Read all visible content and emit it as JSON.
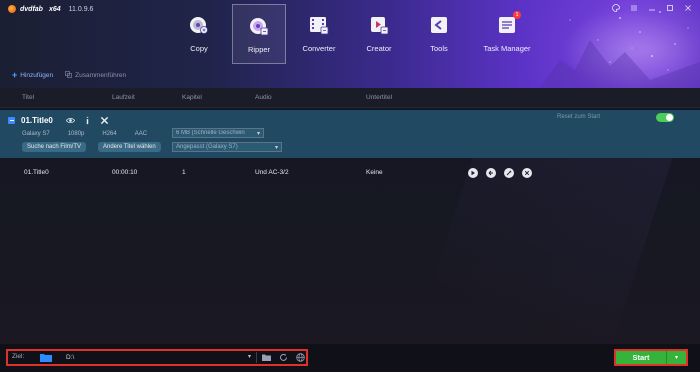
{
  "app": {
    "name": "dvdfab",
    "arch": "x64",
    "version": "11.0.9.6"
  },
  "window_controls": {
    "skin_icon": "palette-icon",
    "menu_icon": "menu-icon",
    "minimize_icon": "minimize-icon",
    "maximize_icon": "maximize-icon",
    "close_icon": "close-icon"
  },
  "nav": {
    "items": [
      {
        "label": "Copy",
        "icon": "copy-disc-icon"
      },
      {
        "label": "Ripper",
        "icon": "ripper-disc-icon"
      },
      {
        "label": "Converter",
        "icon": "film-icon"
      },
      {
        "label": "Creator",
        "icon": "creator-icon"
      },
      {
        "label": "Tools",
        "icon": "tools-icon"
      },
      {
        "label": "Task Manager",
        "icon": "task-manager-icon",
        "badge": "1"
      }
    ]
  },
  "toolbar": {
    "add_label": "Hinzufügen",
    "merge_label": "Zusammenführen"
  },
  "columns": {
    "title": "Titel",
    "duration": "Laufzeit",
    "chapter": "Kapitel",
    "audio": "Audio",
    "subtitle": "Untertitel"
  },
  "title_block": {
    "name": "01.Title0",
    "specs": {
      "device": "Galaxy S7",
      "resolution": "1080p",
      "codec": "H264",
      "audio": "AAC"
    },
    "size_dropdown": "6 MB (Schnelle Geschwin",
    "profile_dropdown": "Angepasst (Galaxy S7)",
    "search_button": "Suche nach Film/TV",
    "other_title_button": "Andere Titel wählen",
    "reset_label": "Reset zum Start",
    "toggle_on": true
  },
  "track": {
    "title": "01.Title0",
    "duration": "00:00:10",
    "chapter": "1",
    "audio": "Und  AC-3/2",
    "subtitle": "Keine"
  },
  "bottom": {
    "dest_label": "Ziel:",
    "path": "D:\\",
    "start_label": "Start"
  },
  "colors": {
    "accent_blue": "#3b8dff",
    "start_green": "#35b33b",
    "highlight_red": "#e0302a",
    "title_block_bg": "#214a62"
  }
}
